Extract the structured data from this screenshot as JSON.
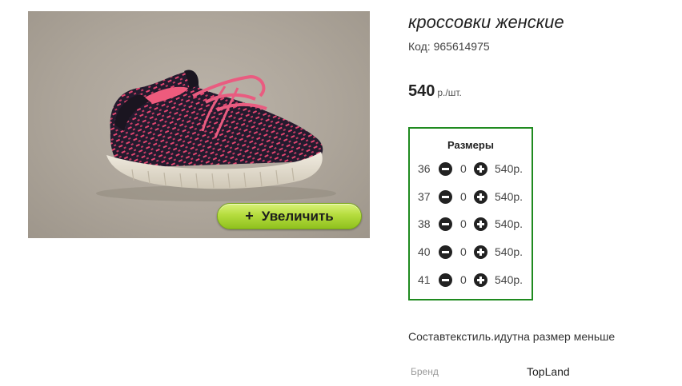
{
  "product": {
    "title": "кроссовки женские",
    "code_label": "Код:",
    "code": "965614975",
    "price": "540",
    "price_unit": "р./шт.",
    "zoom_plus": "+",
    "zoom_label": "Увеличить",
    "description": "Составтекстиль.идутна размер меньше",
    "brand_label": "Бренд",
    "brand_value": "TopLand"
  },
  "sizes": {
    "title": "Размеры",
    "rows": [
      {
        "size": "36",
        "qty": "0",
        "price": "540р."
      },
      {
        "size": "37",
        "qty": "0",
        "price": "540р."
      },
      {
        "size": "38",
        "qty": "0",
        "price": "540р."
      },
      {
        "size": "40",
        "qty": "0",
        "price": "540р."
      },
      {
        "size": "41",
        "qty": "0",
        "price": "540р."
      }
    ]
  },
  "colors": {
    "accent_border": "#1f8a1f",
    "zoom_button": "#b5dc3e",
    "photo_background": "#ada59a"
  },
  "icons": {
    "minus": "minus-circle-icon",
    "plus": "plus-circle-icon"
  }
}
